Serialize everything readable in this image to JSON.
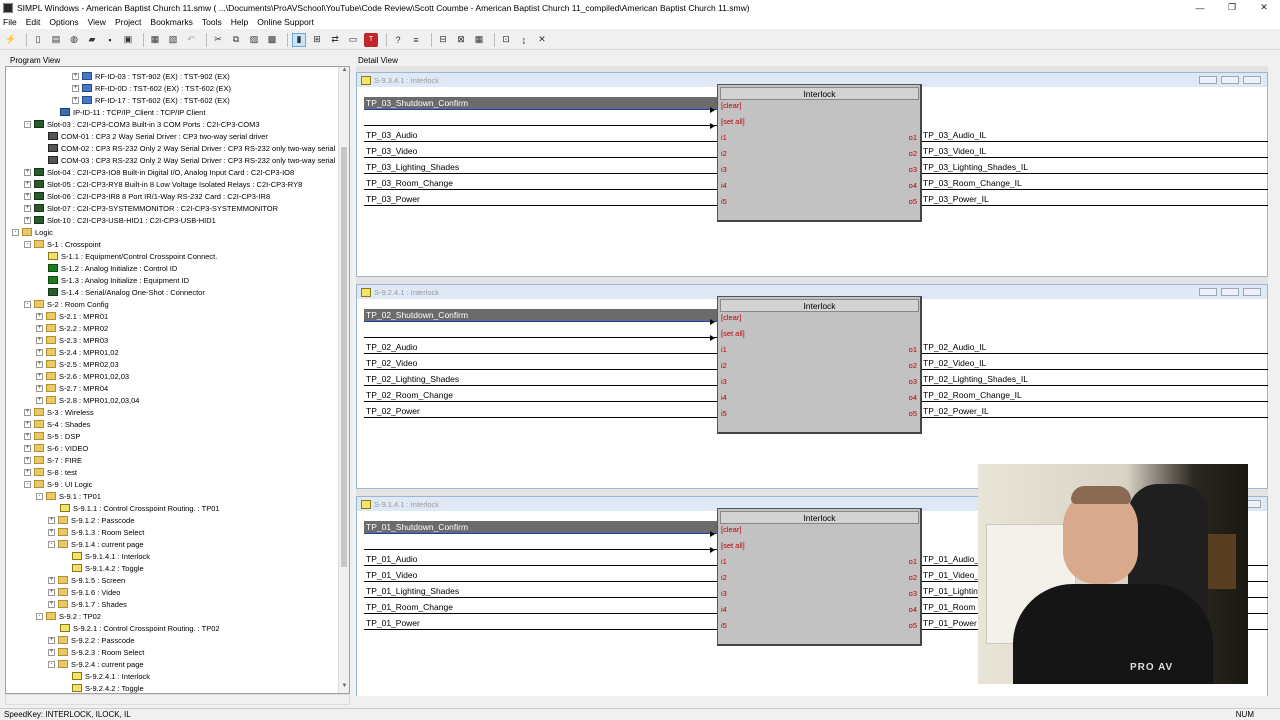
{
  "window": {
    "title": "SIMPL Windows - American Baptist Church 11.smw ( ...\\Documents\\ProAVSchool\\YouTube\\Code Review\\Scott Coumbe - American Baptist Church 11_compiled\\American Baptist Church 11.smw)",
    "minimize": "—",
    "restore": "❐",
    "close": "✕"
  },
  "menu": [
    "File",
    "Edit",
    "Options",
    "View",
    "Project",
    "Bookmarks",
    "Tools",
    "Help",
    "Online Support"
  ],
  "panels": {
    "program_view": "Program View",
    "detail_view": "Detail View"
  },
  "tree": [
    {
      "indent": 5,
      "expander": "+",
      "icon": "rf",
      "label": "RF-ID-03 : TST-902 (EX) : TST-902 (EX)"
    },
    {
      "indent": 5,
      "expander": "+",
      "icon": "rf",
      "label": "RF-ID-0D : TST-602 (EX) : TST-602 (EX)"
    },
    {
      "indent": 5,
      "expander": "+",
      "icon": "rf",
      "label": "RF-ID-17 : TST-602 (EX) : TST-602 (EX)"
    },
    {
      "indent": 4,
      "expander": "",
      "icon": "net",
      "label": "IP-ID-11 : TCP/IP_Client : TCP/IP Client"
    },
    {
      "indent": 1,
      "expander": "-",
      "icon": "card",
      "label": "Slot-03 : C2I-CP3-COM3 Built-in 3 COM Ports : C2I-CP3-COM3"
    },
    {
      "indent": 3,
      "expander": "",
      "icon": "com",
      "label": "COM-01 : CP3 2 Way Serial Driver : CP3 two-way serial driver"
    },
    {
      "indent": 3,
      "expander": "",
      "icon": "com",
      "label": "COM-02 : CP3 RS-232 Only 2 Way Serial Driver : CP3 RS-232 only two-way serial"
    },
    {
      "indent": 3,
      "expander": "",
      "icon": "com",
      "label": "COM-03 : CP3 RS-232 Only 2 Way Serial Driver : CP3 RS-232 only two-way serial"
    },
    {
      "indent": 1,
      "expander": "+",
      "icon": "card",
      "label": "Slot-04 : C2I-CP3-IO8 Built-in Digital I/O, Analog Input Card : C2I-CP3-IO8"
    },
    {
      "indent": 1,
      "expander": "+",
      "icon": "card",
      "label": "Slot-05 : C2I-CP3-RY8 Built-in 8 Low Voltage Isolated Relays : C2I-CP3-RY8"
    },
    {
      "indent": 1,
      "expander": "+",
      "icon": "card",
      "label": "Slot-06 : C2I-CP3-IR8 8 Port IR/1-Way RS-232 Card : C2I-CP3-IR8"
    },
    {
      "indent": 1,
      "expander": "+",
      "icon": "card",
      "label": "Slot-07 : C2I-CP3-SYSTEMMONITOR : C2I-CP3-SYSTEMMONITOR"
    },
    {
      "indent": 1,
      "expander": "+",
      "icon": "card",
      "label": "Slot-10 : C2I-CP3-USB-HID1 : C2I-CP3-USB-HID1"
    },
    {
      "indent": 0,
      "expander": "-",
      "icon": "folder",
      "label": "Logic"
    },
    {
      "indent": 1,
      "expander": "-",
      "icon": "folder",
      "label": "S-1 : Crosspoint"
    },
    {
      "indent": 3,
      "expander": "",
      "icon": "sym",
      "label": "S-1.1 : Equipment/Control Crosspoint Connect."
    },
    {
      "indent": 3,
      "expander": "",
      "icon": "ana",
      "label": "S-1.2 : Analog Initialize : Control ID"
    },
    {
      "indent": 3,
      "expander": "",
      "icon": "ana",
      "label": "S-1.3 : Analog Initialize : Equipment ID"
    },
    {
      "indent": 3,
      "expander": "",
      "icon": "card",
      "label": "S-1.4 : Serial/Analog One-Shot : Connector"
    },
    {
      "indent": 1,
      "expander": "-",
      "icon": "folder",
      "label": "S-2 : Room Config"
    },
    {
      "indent": 2,
      "expander": "+",
      "icon": "folder",
      "label": "S-2.1 : MPR01"
    },
    {
      "indent": 2,
      "expander": "+",
      "icon": "folder",
      "label": "S-2.2 : MPR02"
    },
    {
      "indent": 2,
      "expander": "+",
      "icon": "folder",
      "label": "S-2.3 : MPR03"
    },
    {
      "indent": 2,
      "expander": "+",
      "icon": "folder",
      "label": "S-2.4 : MPR01,02"
    },
    {
      "indent": 2,
      "expander": "+",
      "icon": "folder",
      "label": "S-2.5 : MPR02,03"
    },
    {
      "indent": 2,
      "expander": "+",
      "icon": "folder",
      "label": "S-2.6 : MPR01,02,03"
    },
    {
      "indent": 2,
      "expander": "+",
      "icon": "folder",
      "label": "S-2.7 : MPR04"
    },
    {
      "indent": 2,
      "expander": "+",
      "icon": "folder",
      "label": "S-2.8 : MPR01,02,03,04"
    },
    {
      "indent": 1,
      "expander": "+",
      "icon": "folder",
      "label": "S-3 : Wireless"
    },
    {
      "indent": 1,
      "expander": "+",
      "icon": "folder",
      "label": "S-4 : Shades"
    },
    {
      "indent": 1,
      "expander": "+",
      "icon": "folder",
      "label": "S-5 : DSP"
    },
    {
      "indent": 1,
      "expander": "+",
      "icon": "folder",
      "label": "S-6 : VIDEO"
    },
    {
      "indent": 1,
      "expander": "+",
      "icon": "folder",
      "label": "S-7 : FIRE"
    },
    {
      "indent": 1,
      "expander": "+",
      "icon": "folder",
      "label": "S-8 : test"
    },
    {
      "indent": 1,
      "expander": "-",
      "icon": "folder",
      "label": "S-9 : UI Logic"
    },
    {
      "indent": 2,
      "expander": "-",
      "icon": "folder",
      "label": "S-9.1 : TP01"
    },
    {
      "indent": 4,
      "expander": "",
      "icon": "sym",
      "label": "S-9.1.1 : Control Crosspoint Routing. : TP01"
    },
    {
      "indent": 3,
      "expander": "+",
      "icon": "folder",
      "label": "S-9.1.2 : Passcode"
    },
    {
      "indent": 3,
      "expander": "+",
      "icon": "folder",
      "label": "S-9.1.3 : Room Select"
    },
    {
      "indent": 3,
      "expander": "-",
      "icon": "folder",
      "label": "S-9.1.4 : current page"
    },
    {
      "indent": 5,
      "expander": "",
      "icon": "sym",
      "label": "S-9.1.4.1 : Interlock"
    },
    {
      "indent": 5,
      "expander": "",
      "icon": "sym",
      "label": "S-9.1.4.2 : Toggle"
    },
    {
      "indent": 3,
      "expander": "+",
      "icon": "folder",
      "label": "S-9.1.5 : Screen"
    },
    {
      "indent": 3,
      "expander": "+",
      "icon": "folder",
      "label": "S-9.1.6 : Video"
    },
    {
      "indent": 3,
      "expander": "+",
      "icon": "folder",
      "label": "S-9.1.7 : Shades"
    },
    {
      "indent": 2,
      "expander": "-",
      "icon": "folder",
      "label": "S-9.2 : TP02"
    },
    {
      "indent": 4,
      "expander": "",
      "icon": "sym",
      "label": "S-9.2.1 : Control Crosspoint Routing. : TP02"
    },
    {
      "indent": 3,
      "expander": "+",
      "icon": "folder",
      "label": "S-9.2.2 : Passcode"
    },
    {
      "indent": 3,
      "expander": "+",
      "icon": "folder",
      "label": "S-9.2.3 : Room Select"
    },
    {
      "indent": 3,
      "expander": "-",
      "icon": "folder",
      "label": "S-9.2.4 : current page"
    },
    {
      "indent": 5,
      "expander": "",
      "icon": "sym",
      "label": "S-9.2.4.1 : Interlock"
    },
    {
      "indent": 5,
      "expander": "",
      "icon": "sym",
      "label": "S-9.2.4.2 : Toggle"
    }
  ],
  "detail_windows": [
    {
      "title": "S-9.3.4.1 : Interlock",
      "block_name": "Interlock",
      "inputs": [
        "TP_03_Shutdown_Confirm",
        "",
        "TP_03_Audio",
        "TP_03_Video",
        "TP_03_Lighting_Shades",
        "TP_03_Room_Change",
        "TP_03_Power"
      ],
      "input_pins": [
        "[clear]",
        "[set all]",
        "i1",
        "i2",
        "i3",
        "i4",
        "i5"
      ],
      "output_pins": [
        "o1",
        "o2",
        "o3",
        "o4",
        "o5"
      ],
      "outputs": [
        "TP_03_Audio_IL",
        "TP_03_Video_IL",
        "TP_03_Lighting_Shades_IL",
        "TP_03_Room_Change_IL",
        "TP_03_Power_IL"
      ]
    },
    {
      "title": "S-9.2.4.1 : Interlock",
      "block_name": "Interlock",
      "inputs": [
        "TP_02_Shutdown_Confirm",
        "",
        "TP_02_Audio",
        "TP_02_Video",
        "TP_02_Lighting_Shades",
        "TP_02_Room_Change",
        "TP_02_Power"
      ],
      "input_pins": [
        "[clear]",
        "[set all]",
        "i1",
        "i2",
        "i3",
        "i4",
        "i5"
      ],
      "output_pins": [
        "o1",
        "o2",
        "o3",
        "o4",
        "o5"
      ],
      "outputs": [
        "TP_02_Audio_IL",
        "TP_02_Video_IL",
        "TP_02_Lighting_Shades_IL",
        "TP_02_Room_Change_IL",
        "TP_02_Power_IL"
      ]
    },
    {
      "title": "S-9.1.4.1 : Interlock",
      "block_name": "Interlock",
      "inputs": [
        "TP_01_Shutdown_Confirm",
        "",
        "TP_01_Audio",
        "TP_01_Video",
        "TP_01_Lighting_Shades",
        "TP_01_Room_Change",
        "TP_01_Power"
      ],
      "input_pins": [
        "[clear]",
        "[set all]",
        "i1",
        "i2",
        "i3",
        "i4",
        "i5"
      ],
      "output_pins": [
        "o1",
        "o2",
        "o3",
        "o4",
        "o5"
      ],
      "outputs": [
        "TP_01_Audio_",
        "TP_01_Video_",
        "TP_01_Lightin",
        "TP_01_Room",
        "TP_01_Power"
      ]
    }
  ],
  "webcam": {
    "logo": "PRO AV"
  },
  "status": {
    "speedkey": "SpeedKey: INTERLOCK, ILOCK, IL",
    "num": "NUM"
  },
  "colors": {
    "pin_red": "#c00000",
    "highlight_bar": "#6b6b6b",
    "block_gray": "#c2c2c2"
  }
}
